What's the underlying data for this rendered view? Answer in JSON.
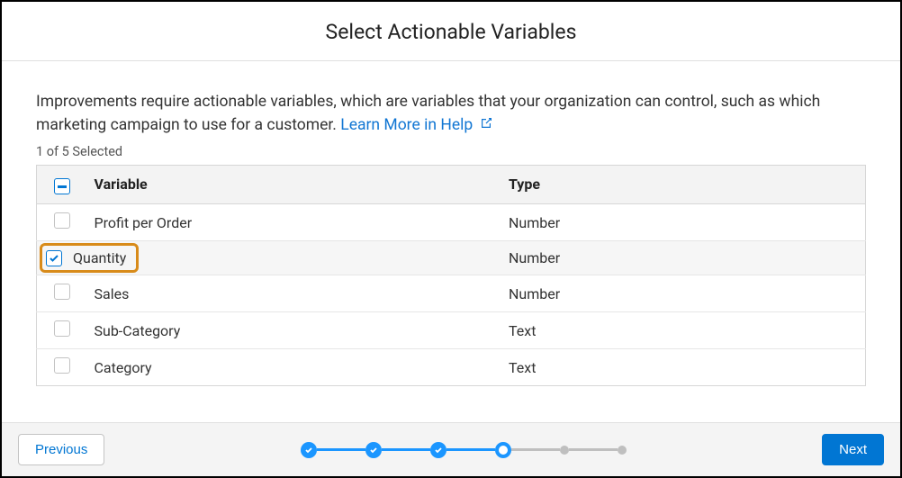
{
  "header": {
    "title": "Select Actionable Variables"
  },
  "description": {
    "text": "Improvements require actionable variables, which are variables that your organization can control, such as which marketing campaign to use for a customer. ",
    "link_text": "Learn More in Help"
  },
  "selection_count": "1 of 5 Selected",
  "table": {
    "headers": {
      "variable": "Variable",
      "type": "Type"
    },
    "rows": [
      {
        "variable": "Profit per Order",
        "type": "Number",
        "checked": false,
        "highlighted": false
      },
      {
        "variable": "Quantity",
        "type": "Number",
        "checked": true,
        "highlighted": true
      },
      {
        "variable": "Sales",
        "type": "Number",
        "checked": false,
        "highlighted": false
      },
      {
        "variable": "Sub-Category",
        "type": "Text",
        "checked": false,
        "highlighted": false
      },
      {
        "variable": "Category",
        "type": "Text",
        "checked": false,
        "highlighted": false
      }
    ]
  },
  "footer": {
    "previous_label": "Previous",
    "next_label": "Next"
  },
  "stepper": {
    "steps": [
      "done",
      "done",
      "done",
      "current",
      "future",
      "future"
    ]
  }
}
